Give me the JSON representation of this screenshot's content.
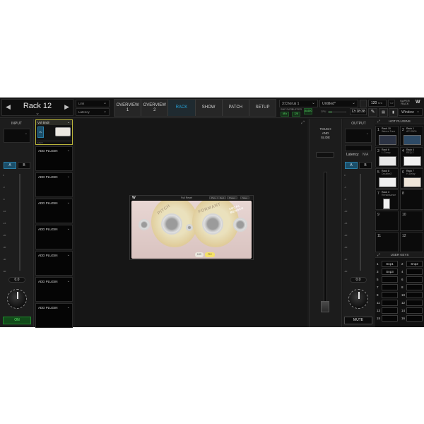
{
  "header": {
    "rack_title": "Rack 12",
    "prev_icon": "◀",
    "next_icon": "▶",
    "expand_icon": "⌄",
    "link_label": "Link",
    "latency_label": "Latency",
    "chevron": "⌄"
  },
  "tabs": [
    {
      "label": "OVERVIEW\n1",
      "active": false
    },
    {
      "label": "OVERVIEW\n2",
      "active": false
    },
    {
      "label": "RACK",
      "active": true
    },
    {
      "label": "SHOW",
      "active": false
    },
    {
      "label": "PATCH",
      "active": false
    },
    {
      "label": "SETUP",
      "active": false
    }
  ],
  "tab_labels": {
    "t0a": "OVERVIEW",
    "t0b": "1",
    "t1a": "OVERVIEW",
    "t1b": "2",
    "t2": "RACK",
    "t3": "SHOW",
    "t4": "PATCH",
    "t5": "SETUP"
  },
  "session": {
    "scene": "3:Chorus 1",
    "session_name": "Untitled*",
    "bpm_value": "120",
    "bpm_unit": "BPM",
    "tap_label": "TAP",
    "sample_rate_label": "SMP RATE",
    "sample_rate": "48 k",
    "buffer_label": "BUFFER",
    "buffer": "128",
    "audio_label": "AUDIO",
    "cpu_label": "CPU",
    "clock": "13:18:38",
    "window_label": "Window",
    "brand_line1": "SUPER",
    "brand_line2": "RACK",
    "brand_logo": "W"
  },
  "input": {
    "label": "INPUT",
    "a_label": "A",
    "b_label": "B",
    "meter_ticks": [
      "0",
      "-3",
      "-6",
      "-10",
      "-15",
      "-20",
      "-30",
      "-40",
      "-60"
    ],
    "gain_value": "0.0",
    "on_label": "ON"
  },
  "slots": {
    "loaded": {
      "name": "Vol Bndr",
      "power_label": "PL",
      "footer": "Lnk  0"
    },
    "add_label": "ADD PLUGIN",
    "empty_count": 7
  },
  "plugin_window": {
    "logo": "W",
    "preset": "Full Reset",
    "buttons": [
      "Prev",
      "Next",
      "Preset",
      "Save"
    ],
    "pitch_label": "PITCH",
    "formant_label": "FORMANT",
    "vocal_label": "VOCAL BENDER",
    "mode_buttons": [
      "MID",
      "FIX"
    ]
  },
  "touch": {
    "label_line1": "TOUCH",
    "label_line2": "AND",
    "label_line3": "SLIDE"
  },
  "output": {
    "label": "OUTPUT",
    "latency_label": "Latency",
    "latency_value": "N/A",
    "a_label": "A",
    "b_label": "B",
    "meter_ticks": [
      "0",
      "-3",
      "-6",
      "-10",
      "-15",
      "-20",
      "-30",
      "-40",
      "-60"
    ],
    "gain_value": "0.0",
    "mute_label": "MUTE"
  },
  "hot_plugins": {
    "title": "HOT PLUGINS",
    "items": [
      {
        "num": "1",
        "rack": "Rack 10",
        "plugin": "Waves Tune",
        "thumb": "#2c3344"
      },
      {
        "num": "2",
        "rack": "Rack 1",
        "plugin": "API 2500",
        "thumb": "#2d4a66"
      },
      {
        "num": "3",
        "rack": "Rack 6",
        "plugin": "L-Comp",
        "thumb": "#e8e8e8"
      },
      {
        "num": "4",
        "rack": "Rack 4",
        "plugin": "REQ 2",
        "thumb": "#f2f2f2"
      },
      {
        "num": "5",
        "rack": "Rack 8",
        "plugin": "Doubler2",
        "thumb": "#f0f0f0"
      },
      {
        "num": "6",
        "rack": "Rack 7",
        "plugin": "H-Delay",
        "thumb": "#efe6da"
      },
      {
        "num": "7",
        "rack": "Rack 3",
        "plugin": "Renaissance",
        "thumb": "#f2f2f2"
      },
      {
        "num": "8",
        "rack": "",
        "plugin": "",
        "thumb": ""
      },
      {
        "num": "9",
        "rack": "",
        "plugin": "",
        "thumb": ""
      },
      {
        "num": "10",
        "rack": "",
        "plugin": "",
        "thumb": ""
      },
      {
        "num": "11",
        "rack": "",
        "plugin": "",
        "thumb": ""
      },
      {
        "num": "12",
        "rack": "",
        "plugin": "",
        "thumb": ""
      }
    ]
  },
  "user_keys": {
    "title": "USER KEYS",
    "keys": [
      {
        "num": "1",
        "label": "Snp1"
      },
      {
        "num": "2",
        "label": "Snp2"
      },
      {
        "num": "3",
        "label": "Snp3"
      },
      {
        "num": "4",
        "label": ""
      },
      {
        "num": "5",
        "label": ""
      },
      {
        "num": "6",
        "label": ""
      },
      {
        "num": "7",
        "label": ""
      },
      {
        "num": "8",
        "label": ""
      },
      {
        "num": "9",
        "label": ""
      },
      {
        "num": "10",
        "label": ""
      },
      {
        "num": "11",
        "label": ""
      },
      {
        "num": "12",
        "label": ""
      },
      {
        "num": "13",
        "label": ""
      },
      {
        "num": "14",
        "label": ""
      },
      {
        "num": "15",
        "label": ""
      },
      {
        "num": "16",
        "label": ""
      }
    ]
  },
  "colors": {
    "accent_blue": "#27a3d9",
    "on_green": "#5ef06c",
    "selected_slot": "#b9b33a"
  }
}
